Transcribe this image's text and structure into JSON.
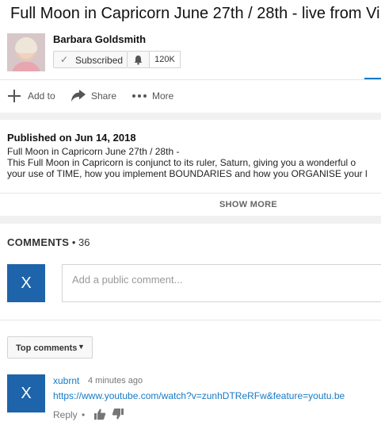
{
  "video": {
    "title": "Full Moon in Capricorn June 27th / 28th - live from Vi"
  },
  "channel": {
    "name": "Barbara Goldsmith",
    "subscribe_label": "Subscribed",
    "subscriber_count": "120K"
  },
  "actions": {
    "add_to": "Add to",
    "share": "Share",
    "more": "More"
  },
  "description": {
    "published": "Published on Jun 14, 2018",
    "lines": [
      "Full Moon in Capricorn June 27th / 28th -",
      "This Full Moon in Capricorn is conjunct to its ruler, Saturn, giving you a wonderful o",
      "your use of TIME, how you implement BOUNDARIES and how you ORGANISE your l"
    ],
    "show_more": "SHOW MORE"
  },
  "comments": {
    "title": "COMMENTS",
    "separator": "•",
    "count": "36",
    "user_avatar_letter": "X",
    "input_placeholder": "Add a public comment...",
    "sort_label": "Top comments",
    "sort_caret": "▼",
    "items": [
      {
        "avatar_letter": "X",
        "author": "xubrnt",
        "time": "4 minutes ago",
        "text": "https://www.youtube.com/watch?v=zunhDTReRFw&feature=youtu.be",
        "reply_label": "Reply",
        "reply_dot": "•"
      }
    ]
  },
  "icons": {
    "check": "✓",
    "bell": "bell-icon",
    "add": "plus-icon",
    "share": "share-arrow-icon",
    "more": "ellipsis-icon",
    "like": "thumbs-up-icon",
    "dislike": "thumbs-down-icon"
  },
  "colors": {
    "link_blue": "#167ac6",
    "avatar_blue": "#1e64aa",
    "band_gray": "#f1f1f1"
  }
}
